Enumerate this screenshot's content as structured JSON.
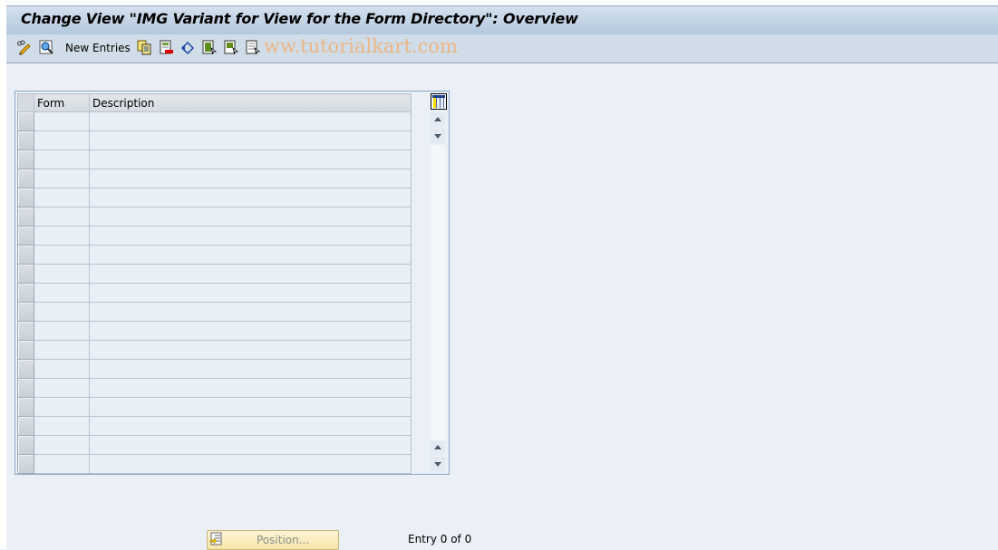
{
  "window": {
    "title": "Change View \"IMG Variant for View for the Form Directory\": Overview"
  },
  "toolbar": {
    "items": [
      {
        "name": "display-change-icon",
        "type": "icon"
      },
      {
        "name": "details-icon",
        "type": "icon"
      },
      {
        "name": "new-entries-button",
        "type": "text",
        "label": "New Entries"
      },
      {
        "name": "copy-as-icon",
        "type": "icon"
      },
      {
        "name": "delete-icon",
        "type": "icon"
      },
      {
        "name": "undo-change-icon",
        "type": "icon"
      },
      {
        "name": "select-all-icon",
        "type": "icon"
      },
      {
        "name": "select-block-icon",
        "type": "icon"
      },
      {
        "name": "deselect-all-icon",
        "type": "icon"
      }
    ],
    "new_entries_label": "New Entries",
    "watermark": "ww.tutorialkart.com"
  },
  "table": {
    "columns": [
      "Form",
      "Description"
    ],
    "rows": [
      [
        "",
        ""
      ],
      [
        "",
        ""
      ],
      [
        "",
        ""
      ],
      [
        "",
        ""
      ],
      [
        "",
        ""
      ],
      [
        "",
        ""
      ],
      [
        "",
        ""
      ],
      [
        "",
        ""
      ],
      [
        "",
        ""
      ],
      [
        "",
        ""
      ],
      [
        "",
        ""
      ],
      [
        "",
        ""
      ],
      [
        "",
        ""
      ],
      [
        "",
        ""
      ],
      [
        "",
        ""
      ],
      [
        "",
        ""
      ],
      [
        "",
        ""
      ],
      [
        "",
        ""
      ],
      [
        "",
        ""
      ]
    ]
  },
  "footer": {
    "position_label": "Position...",
    "entry_text": "Entry 0 of 0"
  },
  "colors": {
    "title_bar": "#c3d4e6",
    "toolbar": "#d0dce7",
    "background": "#eaf0f6",
    "position_button": "#f9ecb9",
    "watermark": "#f0b27a"
  }
}
